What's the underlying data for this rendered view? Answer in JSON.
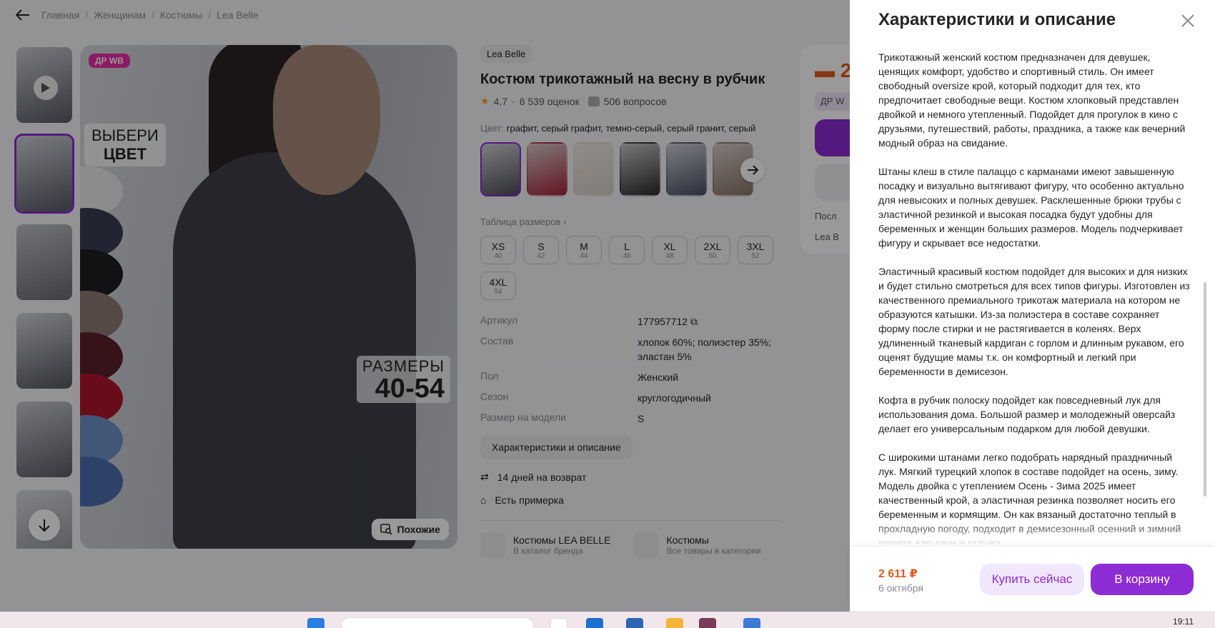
{
  "breadcrumb": {
    "items": [
      "Главная",
      "Женщинам",
      "Костюмы",
      "Lea Belle"
    ]
  },
  "gallery": {
    "badge": "ДР WB",
    "choose_line1": "ВЫБЕРИ",
    "choose_line2": "ЦВЕТ",
    "sizes_line1": "РАЗМЕРЫ",
    "sizes_line2": "40-54",
    "similar": "Похожие",
    "thumbs": [
      "#5a5b66",
      "#565864",
      "#6b6a72",
      "#55565f",
      "#5c5d66",
      "#8d8f98"
    ]
  },
  "product": {
    "brand": "Lea Belle",
    "title": "Костюм трикотажный на весну в рубчик",
    "rating": "4,7",
    "reviews": "6 539 оценок",
    "questions": "506 вопросов",
    "color_label": "Цвет:",
    "color_value": "графит, серый графит, темно-серый, серый гранит, серый",
    "color_thumbs": [
      "#4e4f5a",
      "#a8263a",
      "#d9cfc6",
      "#2b2a2e",
      "#4b4f63",
      "#8b7468"
    ],
    "size_table_label": "Таблица размеров ›",
    "sizes": [
      {
        "s": "XS",
        "n": "40"
      },
      {
        "s": "S",
        "n": "42"
      },
      {
        "s": "M",
        "n": "44"
      },
      {
        "s": "L",
        "n": "46"
      },
      {
        "s": "XL",
        "n": "48"
      },
      {
        "s": "2XL",
        "n": "50"
      },
      {
        "s": "3XL",
        "n": "52"
      },
      {
        "s": "4XL",
        "n": "54"
      }
    ],
    "specs": [
      {
        "k": "Артикул",
        "v": "177957712"
      },
      {
        "k": "Состав",
        "v": "хлопок 60%; полиэстер 35%; эластан 5%"
      },
      {
        "k": "Пол",
        "v": "Женский"
      },
      {
        "k": "Сезон",
        "v": "круглогодичный"
      },
      {
        "k": "Размер на модели",
        "v": "S"
      }
    ],
    "specs_button": "Характеристики и описание",
    "perks": [
      "14 дней на возврат",
      "Есть примерка"
    ],
    "categories": [
      {
        "name": "Костюмы LEA BELLE",
        "sub": "В каталог бренда"
      },
      {
        "name": "Костюмы",
        "sub": "Все товары в категории"
      }
    ]
  },
  "buy_card": {
    "price_partial": "2",
    "badge_partial": "ДР W",
    "line1": "Посл",
    "line2": "Lea B"
  },
  "panel": {
    "title": "Характеристики и описание",
    "paragraphs": [
      "Трикотажный женский костюм предназначен для девушек, ценящих комфорт, удобство и спортивный стиль. Он имеет свободный oversize крой, который подходит для тех, кто предпочитает свободные вещи. Костюм хлопковый представлен двойкой и немного утепленный. Подойдет для прогулок в кино с друзьями, путешествий, работы, праздника, а также как вечерний модный образ на свидание.",
      "Штаны клеш в стиле палаццо с карманами имеют завышенную посадку и визуально вытягивают фигуру, что особенно актуально для невысоких и полных девушек. Расклешенные брюки трубы с эластичной резинкой и высокая посадка будут удобны для беременных и женщин больших размеров. Модель подчеркивает фигуру и скрывает все недостатки.",
      "Эластичный красивый костюм подойдет для высоких и для низких и будет стильно смотреться для всех типов фигуры. Изготовлен из качественного премиального трикотаж материала на котором не образуются катышки. Из-за полиэстера в составе сохраняет форму после стирки и не растягивается в коленях. Верх удлиненный тканевый кардиган с горлом и длинным рукавом, его оценят будущие мамы т.к. он комфортный и легкий при беременности в демисезон.",
      "Кофта в рубчик полоску подойдет как повседневный лук для использования дома. Большой размер и молодежный оверсайз делает его универсальным подарком для любой девушки.",
      "С широкими штанами легко подобрать нарядный праздничный лук. Мягкий турецкий хлопок в составе подойдет на осень, зиму. Модель двойка с утеплением Осень - Зима 2025 имеет качественный крой, а эластичная резинка позволяет носить его беременным и кормящим. Он как вязаный достаточно теплый в прохладную погоду, подходит в демисезонный осенний и зимний период для дачи и отдыха."
    ],
    "price": "2 611 ₽",
    "date": "6 октября",
    "buy_now": "Купить сейчас",
    "to_cart": "В корзину"
  },
  "taskbar": {
    "clock": "19:11"
  }
}
